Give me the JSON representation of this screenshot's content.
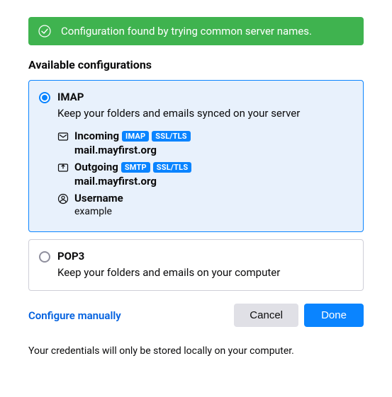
{
  "banner": {
    "message": "Configuration found by trying common server names."
  },
  "section_title": "Available configurations",
  "options": {
    "imap": {
      "title": "IMAP",
      "description": "Keep your folders and emails synced on your server",
      "incoming": {
        "label": "Incoming",
        "protocol_tag": "IMAP",
        "security_tag": "SSL/TLS",
        "host": "mail.mayfirst.org"
      },
      "outgoing": {
        "label": "Outgoing",
        "protocol_tag": "SMTP",
        "security_tag": "SSL/TLS",
        "host": "mail.mayfirst.org"
      },
      "username": {
        "label": "Username",
        "value": "example"
      }
    },
    "pop3": {
      "title": "POP3",
      "description": "Keep your folders and emails on your computer"
    }
  },
  "footer": {
    "configure_manually": "Configure manually",
    "cancel": "Cancel",
    "done": "Done"
  },
  "footnote": "Your credentials will only be stored locally on your computer."
}
